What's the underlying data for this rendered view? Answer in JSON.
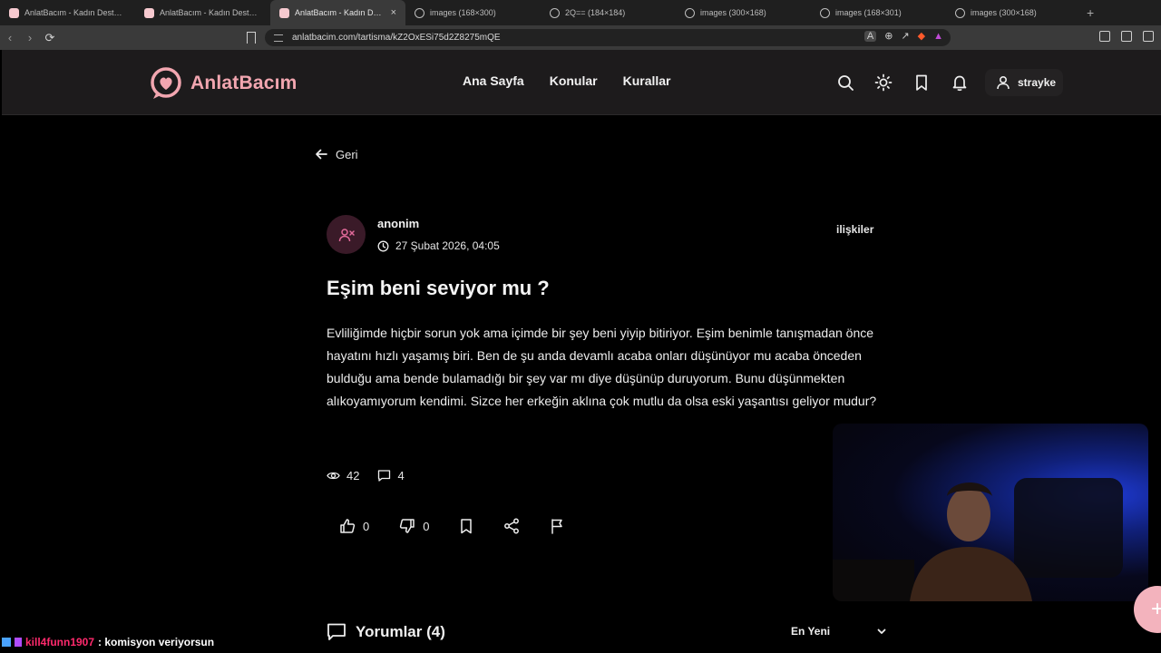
{
  "browser": {
    "tabs": [
      {
        "title": "AnlatBacım - Kadın Destek Platformu",
        "active": false,
        "kind": "site"
      },
      {
        "title": "AnlatBacım - Kadın Destek Platformu",
        "active": false,
        "kind": "site"
      },
      {
        "title": "AnlatBacım - Kadın Destek",
        "active": true,
        "kind": "site"
      },
      {
        "title": "images (168×300)",
        "active": false,
        "kind": "globe"
      },
      {
        "title": "2Q== (184×184)",
        "active": false,
        "kind": "globe"
      },
      {
        "title": "images (300×168)",
        "active": false,
        "kind": "globe"
      },
      {
        "title": "images (168×301)",
        "active": false,
        "kind": "globe"
      },
      {
        "title": "images (300×168)",
        "active": false,
        "kind": "globe"
      }
    ],
    "new_tab": "+",
    "url": "anlatbacim.com/tartisma/kZ2OxESi75d2Z8275mQE"
  },
  "site": {
    "brand": "AnlatBacım",
    "nav": [
      "Ana Sayfa",
      "Konular",
      "Kurallar"
    ],
    "username": "strayke"
  },
  "post": {
    "back_label": "Geri",
    "author": "anonim",
    "date": "27 Şubat 2026, 04:05",
    "category": "ilişkiler",
    "title": "Eşim beni seviyor mu ?",
    "body": "Evliliğimde hiçbir sorun yok  ama içimde bir şey beni yiyip bitiriyor. Eşim benimle tanışmadan önce hayatını hızlı yaşamış biri. Ben de şu anda devamlı acaba onları düşünüyor mu acaba önceden bulduğu ama bende bulamadığı bir şey var mı diye düşünüp duruyorum. Bunu düşünmekten alıkoyamıyorum kendimi. Sizce her erkeğin aklına çok mutlu da olsa eski yaşantısı geliyor mudur?",
    "views": "42",
    "comment_count": "4",
    "likes": "0",
    "dislikes": "0"
  },
  "comments": {
    "heading": "Yorumlar (4)",
    "sort_selected": "En Yeni"
  },
  "stream_chat": {
    "user": "kill4funn1907",
    "message": ": komisyon veriyorsun"
  },
  "colors": {
    "brand_pink": "#f2a6b0",
    "header_bg": "#1d1b1c",
    "avatar_bg": "#3a1a28"
  },
  "icons": [
    "search-icon",
    "sun-icon",
    "bookmark-icon",
    "bell-icon",
    "user-icon",
    "arrow-left-icon",
    "user-x-icon",
    "clock-icon",
    "eye-icon",
    "comment-icon",
    "thumbs-up-icon",
    "thumbs-down-icon",
    "share-icon",
    "flag-icon",
    "chevron-down-icon",
    "plus-icon"
  ]
}
